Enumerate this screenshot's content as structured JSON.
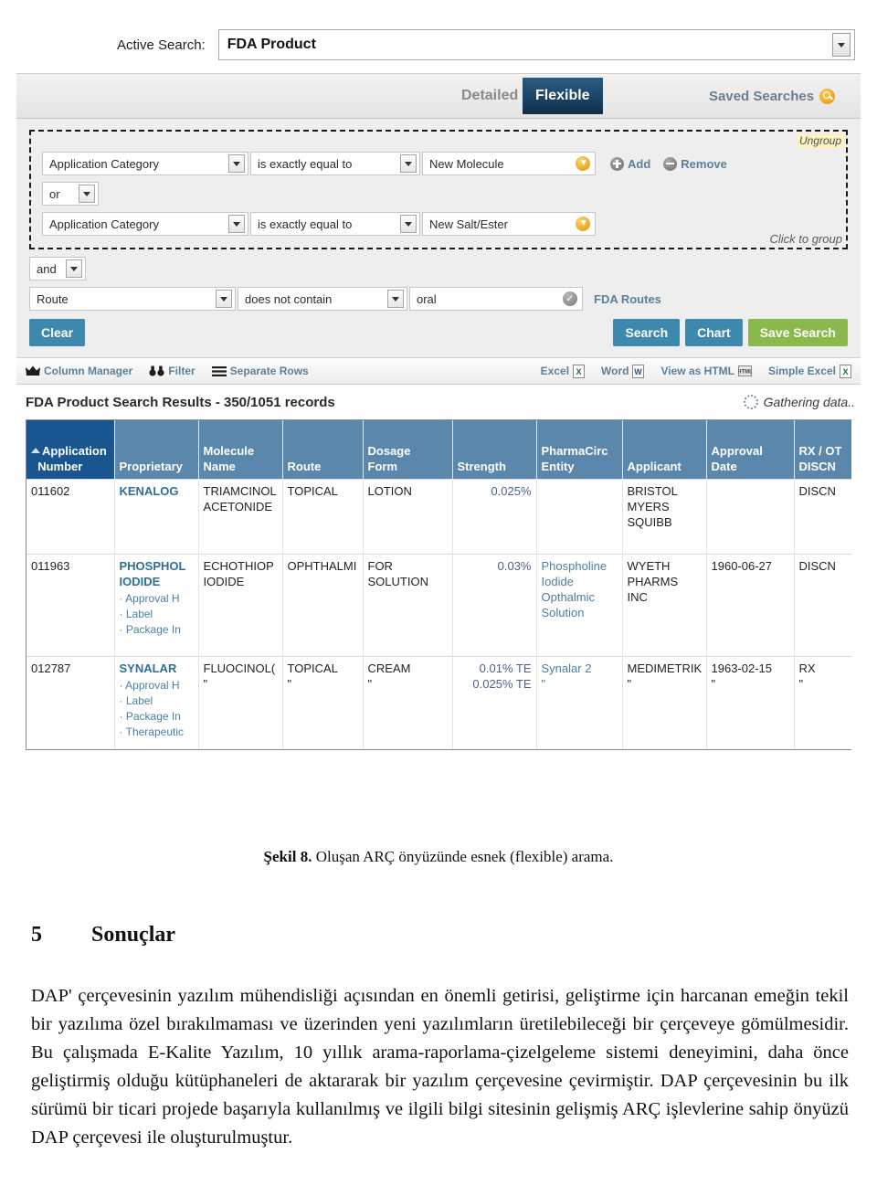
{
  "screenshot": {
    "active_search": {
      "label": "Active Search:",
      "value": "FDA Product"
    },
    "tabs": {
      "detailed": "Detailed",
      "flexible": "Flexible",
      "saved_searches": "Saved Searches"
    },
    "query_builder": {
      "group": {
        "ungroup_label": "Ungroup",
        "click_to_group_label": "Click to group",
        "conditions": [
          {
            "field": "Application Category",
            "operator": "is exactly equal to",
            "value": "New Molecule",
            "add_label": "Add",
            "remove_label": "Remove"
          },
          {
            "field": "Application Category",
            "operator": "is exactly equal to",
            "value": "New Salt/Ester"
          }
        ],
        "inner_logic": "or"
      },
      "outer_logic": "and",
      "route_condition": {
        "field": "Route",
        "operator": "does not contain",
        "value": "oral",
        "link_label": "FDA Routes"
      },
      "buttons": {
        "clear": "Clear",
        "search": "Search",
        "chart": "Chart",
        "save_search": "Save Search"
      }
    },
    "results_toolbar": {
      "left": [
        {
          "label": "Column Manager",
          "icon": "crown-icon"
        },
        {
          "label": "Filter",
          "icon": "binoculars-icon"
        },
        {
          "label": "Separate Rows",
          "icon": "lines-icon"
        }
      ],
      "right": [
        {
          "label": "Excel",
          "icon": "excel-icon"
        },
        {
          "label": "Word",
          "icon": "word-icon"
        },
        {
          "label": "View as HTML",
          "icon": "html-icon"
        },
        {
          "label": "Simple Excel",
          "icon": "excel-icon"
        }
      ]
    },
    "results": {
      "title": "FDA Product Search Results - 350/1051 records",
      "status": "Gathering data..",
      "columns": [
        "Application\nNumber",
        "Proprietary",
        "Molecule\nName",
        "Route",
        "Dosage\nForm",
        "Strength",
        "PharmaCirc\nEntity",
        "Applicant",
        "Approval\nDate",
        "RX / OT\nDISCN"
      ],
      "sorted_column_index": 0,
      "rows": [
        {
          "application_number": "011602",
          "proprietary": "KENALOG",
          "proprietary_sublinks": [],
          "molecule_name": "TRIAMCINOL\nACETONIDE",
          "route": "TOPICAL",
          "dosage_form": "LOTION",
          "strength": "0.025%",
          "pharmacirc_entity": "",
          "applicant": "BRISTOL\nMYERS\nSQUIBB",
          "approval_date": "",
          "rx_otc_discn": "DISCN"
        },
        {
          "application_number": "011963",
          "proprietary": "PHOSPHOL\nIODIDE",
          "proprietary_sublinks": [
            "Approval H",
            "Label",
            "Package In"
          ],
          "molecule_name": "ECHOTHIOP\nIODIDE",
          "route": "OPHTHALMI",
          "dosage_form": "FOR\nSOLUTION",
          "strength": "0.03%",
          "pharmacirc_entity": "Phospholine\nIodide\nOpthalmic\nSolution",
          "applicant": "WYETH\nPHARMS\nINC",
          "approval_date": "1960-06-27",
          "rx_otc_discn": "DISCN"
        },
        {
          "application_number": "012787",
          "proprietary": "SYNALAR",
          "proprietary_sublinks": [
            "Approval H",
            "Label",
            "Package In",
            "Therapeutic"
          ],
          "molecule_name": "FLUOCINOL(",
          "molecule_name_2": "\"",
          "route": "TOPICAL",
          "route_2": "\"",
          "dosage_form": "CREAM",
          "dosage_form_2": "\"",
          "strength": "0.01% TE",
          "strength_2": "0.025% TE",
          "pharmacirc_entity": "Synalar 2",
          "pharmacirc_entity_2": "\"",
          "applicant": "MEDIMETRIK",
          "applicant_2": "\"",
          "approval_date": "1963-02-15",
          "approval_date_2": "\"",
          "rx_otc_discn": "RX",
          "rx_otc_discn_2": "\""
        }
      ]
    }
  },
  "document": {
    "caption_prefix": "Şekil 8.",
    "caption_text": " Oluşan ARÇ önyüzünde esnek (flexible) arama.",
    "section_number": "5",
    "section_title": "Sonuçlar",
    "paragraph": "DAP' çerçevesinin yazılım mühendisliği açısından en önemli getirisi, geliştirme için harcanan emeğin tekil bir yazılıma özel bırakılmaması ve üzerinden yeni yazılımların üretilebileceği bir çerçeveye gömülmesidir. Bu çalışmada E-Kalite Yazılım, 10 yıllık arama-raporlama-çizelgeleme sistemi deneyimini, daha önce geliştirmiş olduğu kütüphaneleri de aktararak bir yazılım çerçevesine çevirmiştir. DAP çerçevesinin bu ilk sürümü bir ticari projede başarıyla kullanılmış ve ilgili bilgi sitesinin gelişmiş ARÇ işlevlerine sahip önyüzü DAP çerçevesi ile oluşturulmuştur."
  }
}
